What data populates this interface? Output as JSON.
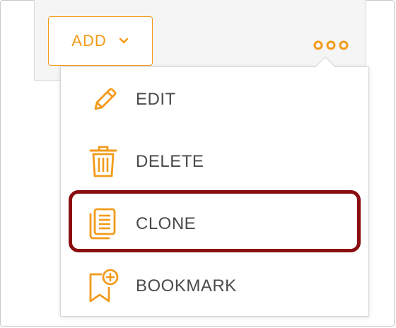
{
  "toolbar": {
    "add_label": "ADD",
    "add_icon": "chevron-down-icon",
    "more_icon": "more-options-icon"
  },
  "menu": {
    "items": [
      {
        "label": "EDIT",
        "icon": "pencil-icon"
      },
      {
        "label": "DELETE",
        "icon": "trash-icon"
      },
      {
        "label": "CLONE",
        "icon": "copy-icon",
        "highlighted": true
      },
      {
        "label": "BOOKMARK",
        "icon": "bookmark-add-icon"
      }
    ]
  },
  "colors": {
    "accent": "#f39a1a",
    "highlight": "#8b0c0f",
    "text": "#4a4a4a"
  }
}
